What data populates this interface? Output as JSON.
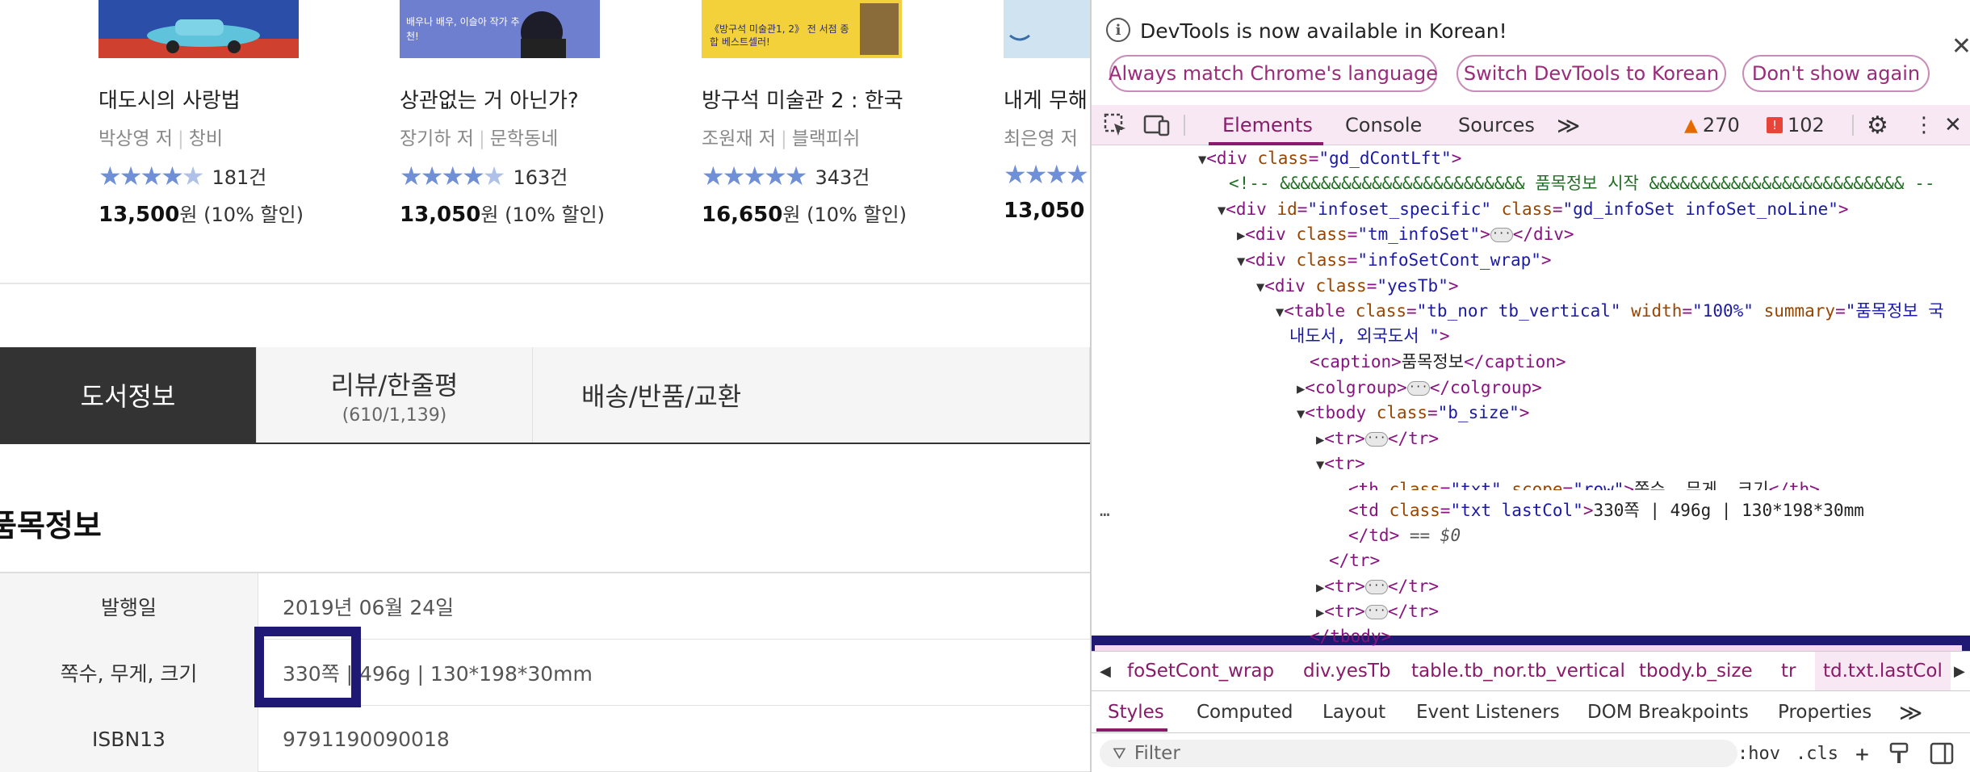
{
  "books": [
    {
      "title": "대도시의 사랑법",
      "author": "박상영 저",
      "publisher": "창비",
      "rating_count": "181건",
      "price": "13,500",
      "price_unit": "원",
      "discount": "(10% 할인)",
      "rating": 4.5,
      "cover_text": "",
      "cover_color": "#2b4fa8"
    },
    {
      "title": "상관없는 거 아닌가?",
      "author": "장기하 저",
      "publisher": "문학동네",
      "rating_count": "163건",
      "price": "13,050",
      "price_unit": "원",
      "discount": "(10% 할인)",
      "rating": 4.5,
      "cover_text": "배우나 배우, 이슬아 작가 추천!",
      "cover_color": "#6f7fd0"
    },
    {
      "title": "방구석 미술관 2 : 한국",
      "author": "조원재 저",
      "publisher": "블랙피쉬",
      "rating_count": "343건",
      "price": "16,650",
      "price_unit": "원",
      "discount": "(10% 할인)",
      "rating": 5,
      "cover_text": "《방구석 미술관1, 2》 전 서점 종합 베스트셀러!",
      "cover_color": "#f2d13a"
    },
    {
      "title": "내게 무해",
      "author": "최은영 저",
      "publisher": "",
      "rating_count": "",
      "price": "13,050",
      "price_unit": "",
      "discount": "",
      "rating": 4.5,
      "cover_text": "",
      "cover_color": "#cfe3f1"
    }
  ],
  "tabs": [
    {
      "label": "도서정보",
      "sub": ""
    },
    {
      "label": "리뷰/한줄평",
      "sub": "(610/1,139)"
    },
    {
      "label": "배송/반품/교환",
      "sub": ""
    }
  ],
  "section_title": "품목정보",
  "info_rows": [
    {
      "label": "발행일",
      "value": "2019년 06월 24일"
    },
    {
      "label": "쪽수, 무게, 크기",
      "value": "330쪽 | 496g | 130*198*30mm"
    },
    {
      "label": "ISBN13",
      "value": "9791190090018"
    }
  ],
  "devtools": {
    "banner": {
      "message": "DevTools is now available in Korean!",
      "buttons": [
        "Always match Chrome's language",
        "Switch DevTools to Korean",
        "Don't show again"
      ],
      "close": "✕"
    },
    "toolbar": {
      "tabs": [
        "Elements",
        "Console",
        "Sources"
      ],
      "more": "≫",
      "warnings": "270",
      "errors": "102"
    },
    "dom_lines": [
      {
        "indent": 0,
        "tri": "▼",
        "html": "<div class=\"gd_dContLft\">"
      },
      {
        "indent": 1,
        "tri": "",
        "comment": "<!-- &&&&&&&&&&&&&&&&&&&&&&&& 품목정보 시작 &&&&&&&&&&&&&&&&&&&&&&&&& --"
      },
      {
        "indent": 1,
        "tri": "▼",
        "html": "<div id=\"infoset_specific\" class=\"gd_infoSet infoSet_noLine\">"
      },
      {
        "indent": 2,
        "tri": "▶",
        "html": "<div class=\"tm_infoSet\">…</div>"
      },
      {
        "indent": 2,
        "tri": "▼",
        "html": "<div class=\"infoSetCont_wrap\">"
      },
      {
        "indent": 3,
        "tri": "▼",
        "html": "<div class=\"yesTb\">"
      },
      {
        "indent": 4,
        "tri": "▼",
        "html": "<table class=\"tb_nor tb_vertical\" width=\"100%\" summary=\"품목정보 국"
      },
      {
        "indent": 4,
        "tri": "",
        "text": "내도서, 외국도서 \">"
      },
      {
        "indent": 5,
        "tri": "",
        "html": "<caption>품목정보</caption>"
      },
      {
        "indent": 5,
        "tri": "▶",
        "html": "<colgroup>…</colgroup>"
      },
      {
        "indent": 5,
        "tri": "▼",
        "html": "<tbody class=\"b_size\">"
      },
      {
        "indent": 6,
        "tri": "▶",
        "html": "<tr>…</tr>"
      },
      {
        "indent": 6,
        "tri": "▼",
        "html": "<tr>"
      },
      {
        "indent": 7,
        "tri": "",
        "html": "<th class=\"txt\" scope=\"row\">쪽수, 무게, 크기</th>"
      },
      {
        "indent": 7,
        "tri": "",
        "html": "<td class=\"txt lastCol\">330쪽 | 496g | 130*198*30mm"
      },
      {
        "indent": 7,
        "tri": "",
        "html": "</td> == $0"
      },
      {
        "indent": 6,
        "tri": "",
        "html": "</tr>"
      },
      {
        "indent": 6,
        "tri": "▶",
        "html": "<tr>…</tr>"
      },
      {
        "indent": 6,
        "tri": "▶",
        "html": "<tr>…</tr>"
      },
      {
        "indent": 5,
        "tri": "",
        "html": "</tbody>"
      }
    ],
    "breadcrumbs": [
      "foSetCont_wrap",
      "div.yesTb",
      "table.tb_nor.tb_vertical",
      "tbody.b_size",
      "tr",
      "td.txt.lastCol"
    ],
    "styles_tabs": [
      "Styles",
      "Computed",
      "Layout",
      "Event Listeners",
      "DOM Breakpoints",
      "Properties"
    ],
    "filter_placeholder": "Filter",
    "filter_buttons": [
      ":hov",
      ".cls"
    ]
  }
}
